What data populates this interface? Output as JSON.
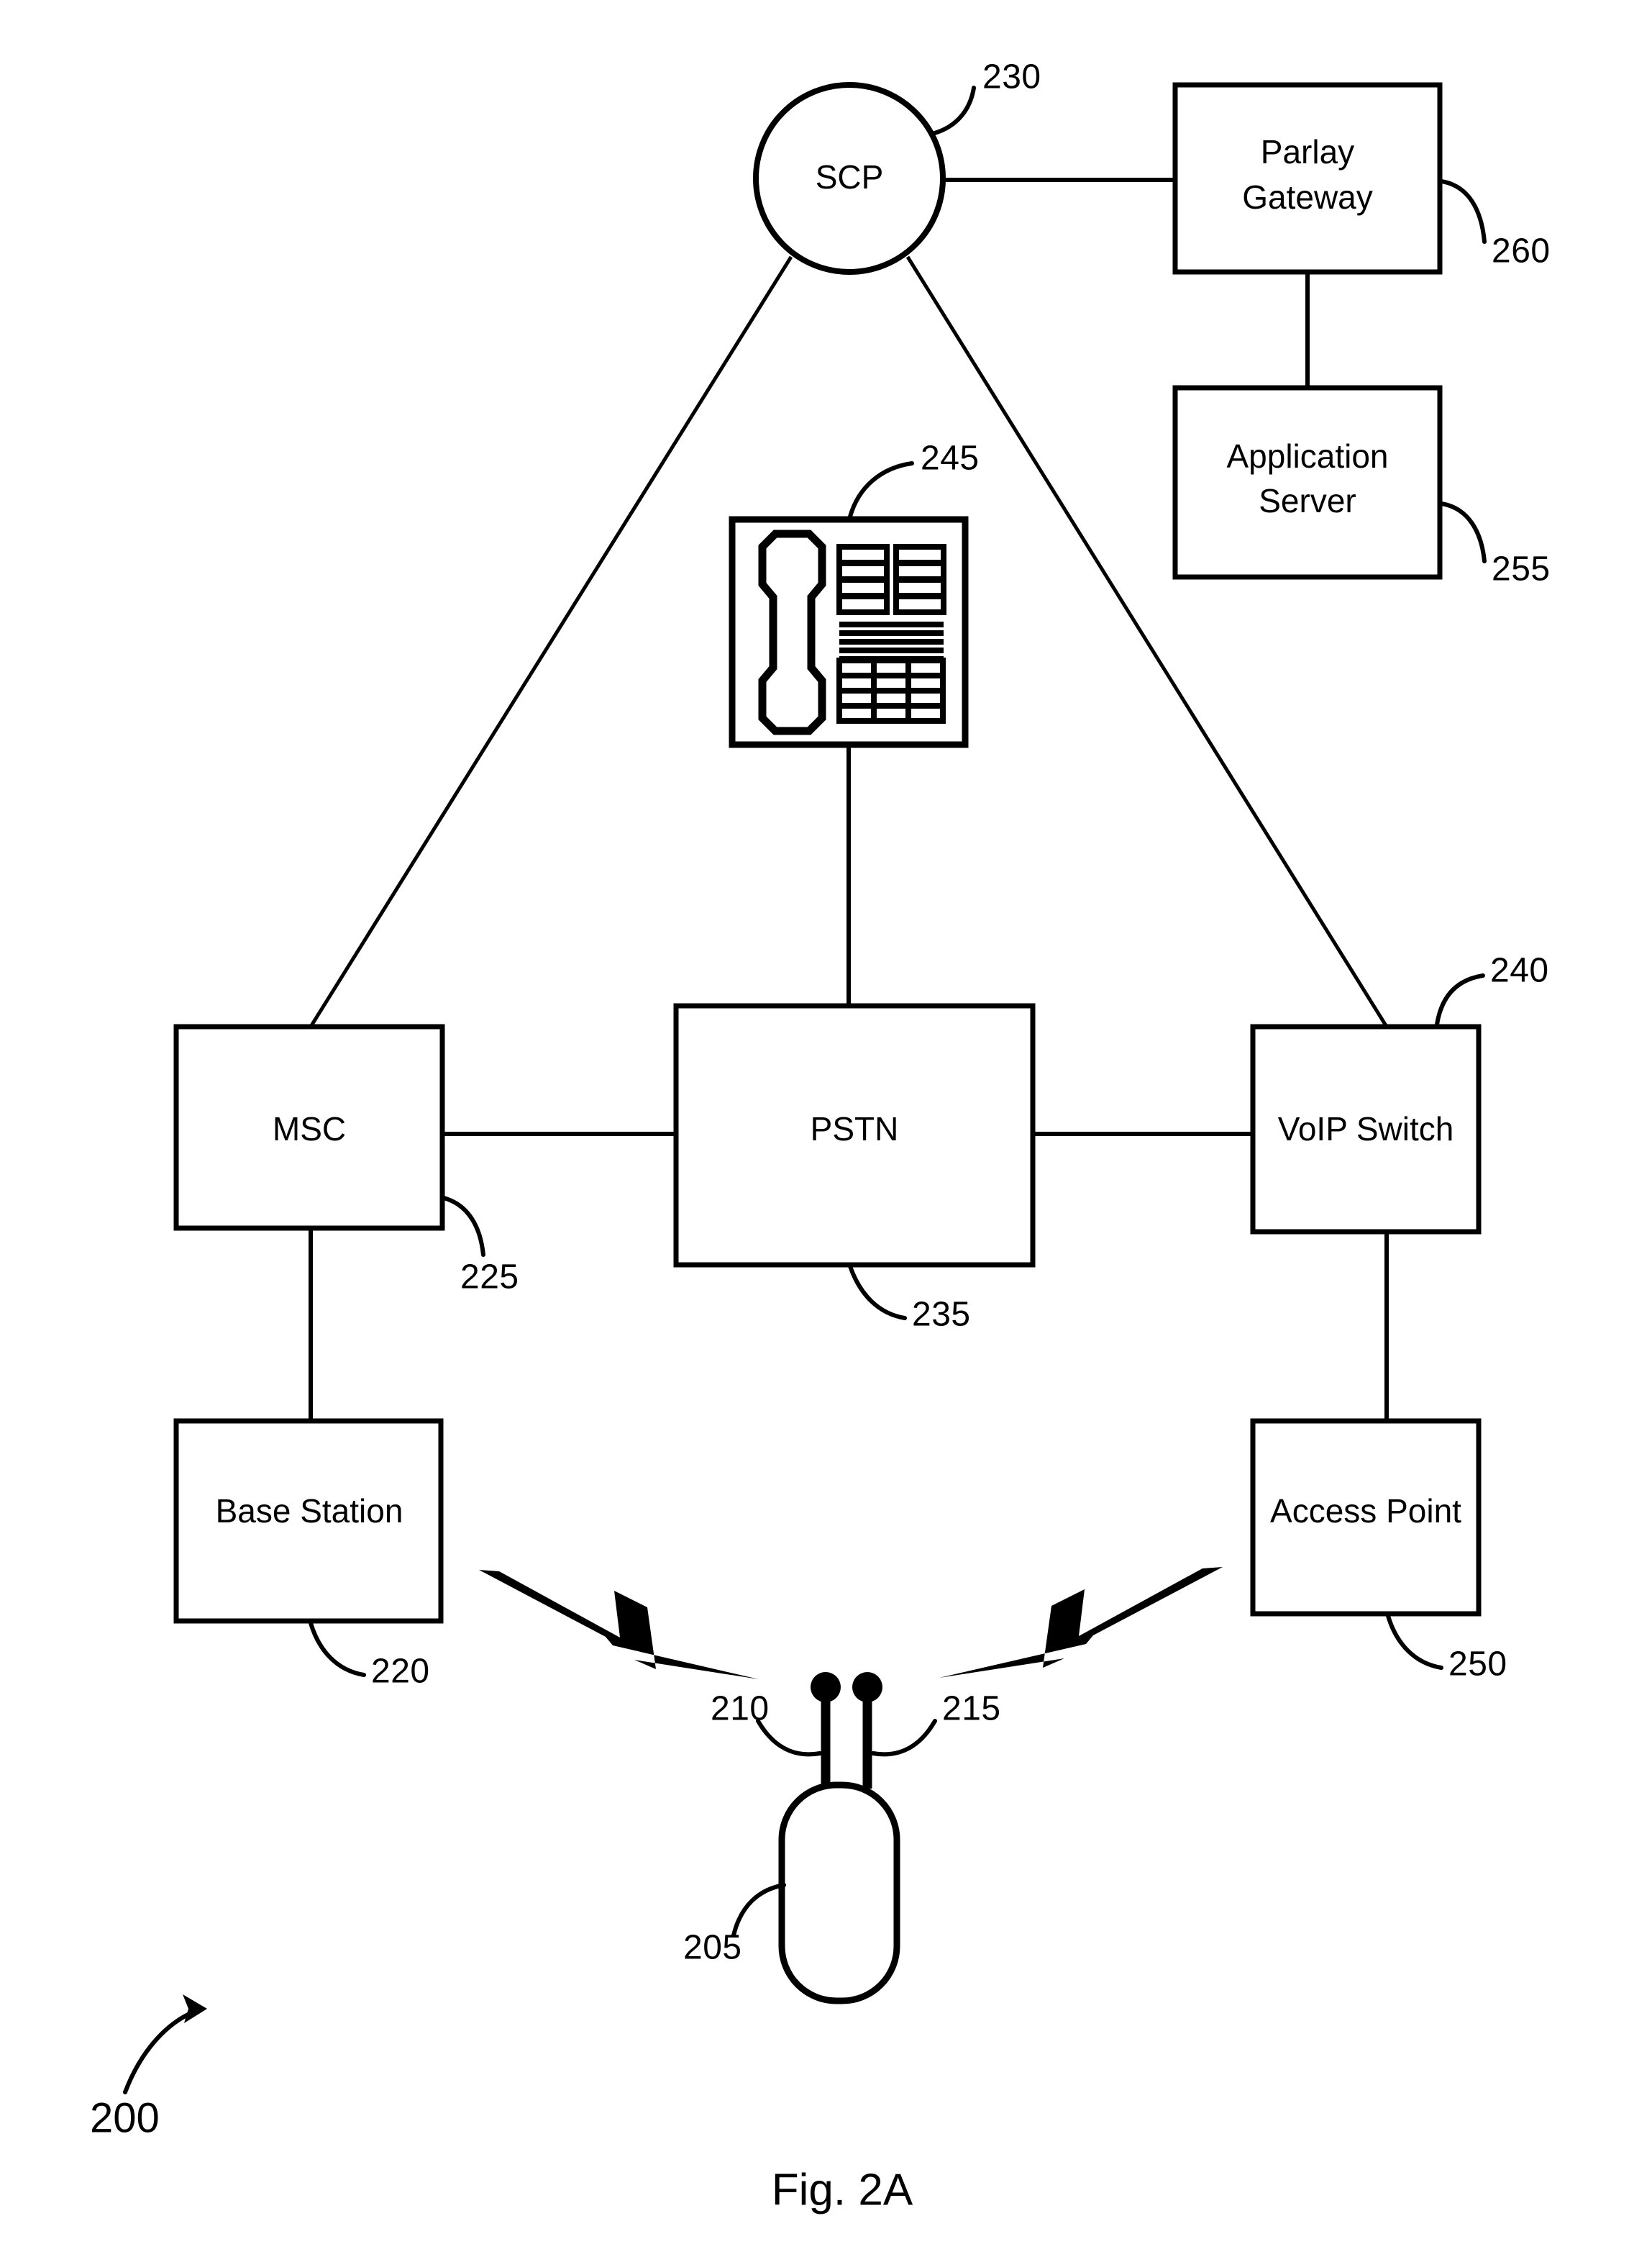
{
  "figure": {
    "caption": "Fig. 2A",
    "system_ref": "200"
  },
  "nodes": {
    "scp": {
      "label": "SCP",
      "ref": "230"
    },
    "parlay_gateway": {
      "label_line1": "Parlay",
      "label_line2": "Gateway",
      "ref": "260"
    },
    "application_server": {
      "label_line1": "Application",
      "label_line2": "Server",
      "ref": "255"
    },
    "desk_phone": {
      "label": "",
      "ref": "245"
    },
    "msc": {
      "label": "MSC",
      "ref": "225"
    },
    "pstn": {
      "label": "PSTN",
      "ref": "235"
    },
    "voip_switch": {
      "label": "VoIP Switch",
      "ref": "240"
    },
    "base_station": {
      "label": "Base Station",
      "ref": "220"
    },
    "access_point": {
      "label": "Access Point",
      "ref": "250"
    },
    "mobile_device": {
      "label": "",
      "ref": "205"
    },
    "antenna_left": {
      "label": "",
      "ref": "210"
    },
    "antenna_right": {
      "label": "",
      "ref": "215"
    }
  },
  "colors": {
    "ink": "#000000",
    "paper": "#ffffff"
  }
}
